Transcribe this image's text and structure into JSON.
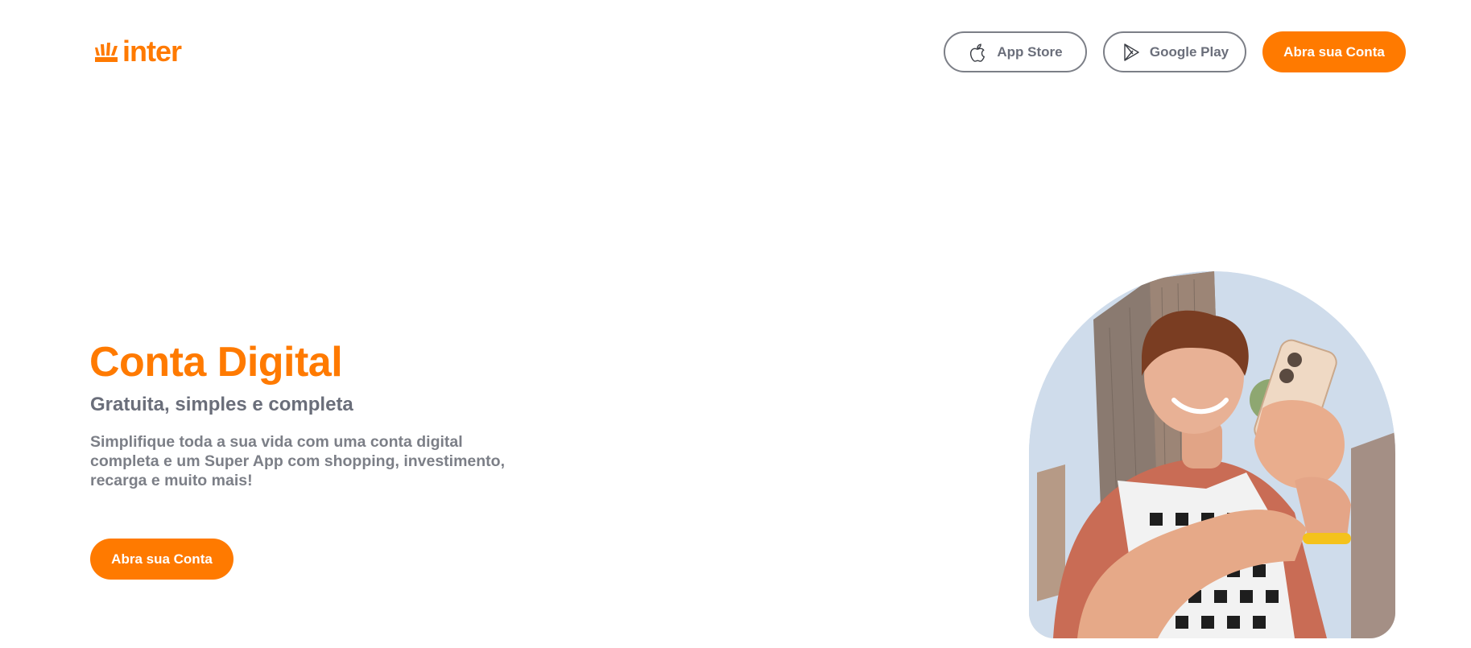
{
  "brand": {
    "name": "inter",
    "accent_color": "#ff7a00",
    "text_color": "#6a6e7a"
  },
  "header": {
    "logo_text": "inter",
    "app_store_label": "App Store",
    "app_store_icon": "apple-icon",
    "google_play_label": "Google Play",
    "google_play_icon": "play-store-icon",
    "cta_label": "Abra sua Conta"
  },
  "hero": {
    "title": "Conta Digital",
    "subtitle": "Gratuita, simples e completa",
    "description": "Simplifique toda a sua vida com uma conta digital completa e um Super App com shopping, investimento, recarga e muito mais!",
    "cta_label": "Abra sua Conta"
  },
  "image": {
    "subject": "young man smiling looking at smartphone in front of tall buildings"
  }
}
